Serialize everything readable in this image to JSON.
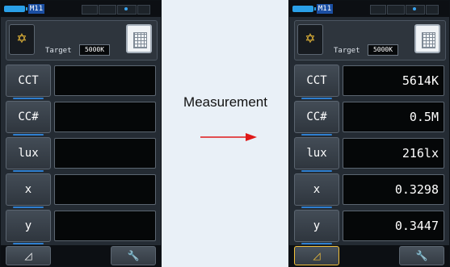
{
  "caption": "Measurement",
  "left_screen": {
    "mode_chip": "M11",
    "target_label": "Target",
    "target_value": "5000K",
    "rows": [
      {
        "label": "CCT",
        "value": ""
      },
      {
        "label": "CC#",
        "value": ""
      },
      {
        "label": "lux",
        "value": ""
      },
      {
        "label": "x",
        "value": ""
      },
      {
        "label": "y",
        "value": ""
      }
    ],
    "bottom_left_icon": "delta-icon",
    "bottom_right_icon": "wrench-icon"
  },
  "right_screen": {
    "mode_chip": "M11",
    "target_label": "Target",
    "target_value": "5000K",
    "rows": [
      {
        "label": "CCT",
        "value": "5614K"
      },
      {
        "label": "CC#",
        "value": "0.5M"
      },
      {
        "label": "lux",
        "value": "216lx"
      },
      {
        "label": "x",
        "value": "0.3298"
      },
      {
        "label": "y",
        "value": "0.3447"
      }
    ],
    "bottom_left_icon": "delta-icon",
    "bottom_right_icon": "wrench-icon"
  },
  "colors": {
    "accent_blue": "#2f7fd0",
    "icon_yellow": "#f3c13a",
    "arrow_red": "#e01818"
  }
}
